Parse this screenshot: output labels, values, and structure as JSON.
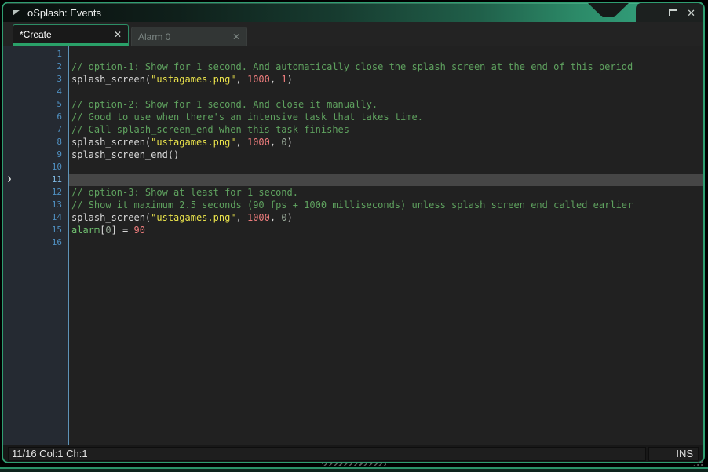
{
  "window": {
    "title": "oSplash: Events",
    "close_glyph": "✕"
  },
  "tabs": [
    {
      "label": "*Create",
      "close_glyph": "✕",
      "active": true
    },
    {
      "label": "Alarm 0",
      "close_glyph": "✕",
      "active": false
    }
  ],
  "editor": {
    "total_lines": 16,
    "current_line": 11,
    "current_line_arrow": "❯",
    "lines": [
      {
        "n": 1,
        "tokens": []
      },
      {
        "n": 2,
        "tokens": [
          [
            "comment",
            "// option-1: Show for 1 second. And automatically close the splash screen at the end of this period"
          ]
        ]
      },
      {
        "n": 3,
        "tokens": [
          [
            "plain",
            "splash_screen("
          ],
          [
            "string",
            "\"ustagames.png\""
          ],
          [
            "plain",
            ", "
          ],
          [
            "number",
            "1000"
          ],
          [
            "plain",
            ", "
          ],
          [
            "number",
            "1"
          ],
          [
            "plain",
            ")"
          ]
        ]
      },
      {
        "n": 4,
        "tokens": []
      },
      {
        "n": 5,
        "tokens": [
          [
            "comment",
            "// option-2: Show for 1 second. And close it manually."
          ]
        ]
      },
      {
        "n": 6,
        "tokens": [
          [
            "comment",
            "// Good to use when there's an intensive task that takes time."
          ]
        ]
      },
      {
        "n": 7,
        "tokens": [
          [
            "comment",
            "// Call splash_screen_end when this task finishes"
          ]
        ]
      },
      {
        "n": 8,
        "tokens": [
          [
            "plain",
            "splash_screen("
          ],
          [
            "string",
            "\"ustagames.png\""
          ],
          [
            "plain",
            ", "
          ],
          [
            "number",
            "1000"
          ],
          [
            "plain",
            ", "
          ],
          [
            "zero",
            "0"
          ],
          [
            "plain",
            ")"
          ]
        ]
      },
      {
        "n": 9,
        "tokens": [
          [
            "plain",
            "splash_screen_end()"
          ]
        ]
      },
      {
        "n": 10,
        "tokens": []
      },
      {
        "n": 11,
        "tokens": []
      },
      {
        "n": 12,
        "tokens": [
          [
            "comment",
            "// option-3: Show at least for 1 second."
          ]
        ]
      },
      {
        "n": 13,
        "tokens": [
          [
            "comment",
            "// Show it maximum 2.5 seconds (90 fps + 1000 milliseconds) unless splash_screen_end called earlier"
          ]
        ]
      },
      {
        "n": 14,
        "tokens": [
          [
            "plain",
            "splash_screen("
          ],
          [
            "string",
            "\"ustagames.png\""
          ],
          [
            "plain",
            ", "
          ],
          [
            "number",
            "1000"
          ],
          [
            "plain",
            ", "
          ],
          [
            "zero",
            "0"
          ],
          [
            "plain",
            ")"
          ]
        ]
      },
      {
        "n": 15,
        "tokens": [
          [
            "builtin",
            "alarm"
          ],
          [
            "plain",
            "["
          ],
          [
            "zero",
            "0"
          ],
          [
            "plain",
            "] = "
          ],
          [
            "number",
            "90"
          ]
        ]
      },
      {
        "n": 16,
        "tokens": []
      }
    ]
  },
  "status": {
    "left": "11/16 Col:1 Ch:1",
    "right": "INS"
  },
  "colors": {
    "accent": "#2f9e71",
    "comment": "#5fa25f",
    "string": "#e9e24b",
    "number": "#ef7d7d",
    "zero": "#9aab9a",
    "plain": "#d8d8d8",
    "builtin": "#6fbf6f",
    "linenum": "#4f8fc0",
    "linenumCur": "#7fb9e3",
    "curLineBg": "#464646"
  }
}
